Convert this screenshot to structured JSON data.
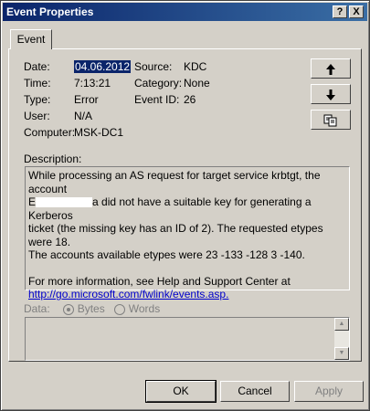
{
  "window": {
    "title": "Event Properties",
    "help_glyph": "?",
    "close_glyph": "X"
  },
  "tab": {
    "label": "Event"
  },
  "fields": {
    "date_label": "Date:",
    "date_value": "04.06.2012",
    "source_label": "Source:",
    "source_value": "KDC",
    "time_label": "Time:",
    "time_value": "7:13:21",
    "category_label": "Category:",
    "category_value": "None",
    "type_label": "Type:",
    "type_value": "Error",
    "event_id_label": "Event ID:",
    "event_id_value": "26",
    "user_label": "User:",
    "user_value": "N/A",
    "computer_label": "Computer:",
    "computer_value": "MSK-DC1"
  },
  "nav": {
    "up_icon": "up-arrow-icon",
    "down_icon": "down-arrow-icon",
    "copy_icon": "copy-icon"
  },
  "description": {
    "label": "Description:",
    "line1": "While processing an AS request for target service krbtgt, the account",
    "line2_prefix": "E",
    "line2_suffix": "a did not  have a suitable key for generating a Kerberos",
    "line3": "ticket (the missing key has an ID of 2). The requested etypes were 18.",
    "line4": "The accounts available etypes were 23  -133  -128  3  -140.",
    "more_info": "For more information, see Help and Support Center at",
    "link": "http://go.microsoft.com/fwlink/events.asp."
  },
  "data_section": {
    "label": "Data:",
    "bytes_label": "Bytes",
    "words_label": "Words"
  },
  "buttons": {
    "ok": "OK",
    "cancel": "Cancel",
    "apply": "Apply"
  }
}
